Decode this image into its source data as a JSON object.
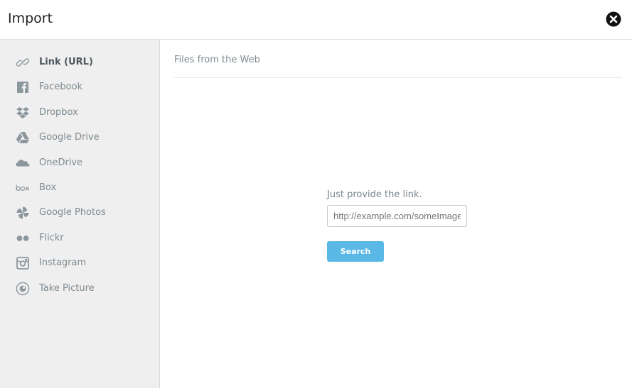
{
  "header": {
    "title": "Import",
    "close_icon": "close-circle-icon"
  },
  "sidebar": {
    "active_index": 0,
    "items": [
      {
        "label": "Link (URL)",
        "icon": "link-icon"
      },
      {
        "label": "Facebook",
        "icon": "facebook-icon"
      },
      {
        "label": "Dropbox",
        "icon": "dropbox-icon"
      },
      {
        "label": "Google Drive",
        "icon": "google-drive-icon"
      },
      {
        "label": "OneDrive",
        "icon": "onedrive-icon"
      },
      {
        "label": "Box",
        "icon": "box-icon"
      },
      {
        "label": "Google Photos",
        "icon": "google-photos-icon"
      },
      {
        "label": "Flickr",
        "icon": "flickr-icon"
      },
      {
        "label": "Instagram",
        "icon": "instagram-icon"
      },
      {
        "label": "Take Picture",
        "icon": "camera-icon"
      }
    ]
  },
  "main": {
    "section_title": "Files from the Web",
    "prompt": "Just provide the link.",
    "url_input": {
      "value": "",
      "placeholder": "http://example.com/someImage.jpg"
    },
    "search_label": "Search"
  },
  "colors": {
    "accent": "#5ab8e7",
    "sidebar_bg": "#efefef",
    "icon_gray": "#8c979d"
  }
}
